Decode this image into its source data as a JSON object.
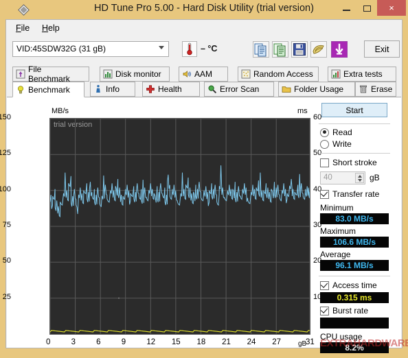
{
  "window": {
    "title": "HD Tune Pro 5.00 - Hard Disk Utility (trial version)",
    "logo_icon": "diamond-logo-icon",
    "minimize_label": "minimize",
    "maximize_label": "maximize",
    "close_label": "×",
    "titlebar_color": "#e8c77e",
    "close_color": "#c75b57"
  },
  "menu": {
    "items": [
      {
        "accel": "F",
        "rest": "ile"
      },
      {
        "accel": "H",
        "rest": "elp"
      }
    ]
  },
  "toolbar": {
    "drive": "VID:45SDW32G (31 gB)",
    "drive_caret_icon": "chevron-down-icon",
    "temperature_icon": "thermometer-icon",
    "temperature": "– °C",
    "buttons": [
      {
        "name": "copy-to-clipboard-icon"
      },
      {
        "name": "copy-to-excel-icon"
      },
      {
        "name": "save-icon"
      },
      {
        "name": "screenshot-icon"
      },
      {
        "name": "download-icon"
      }
    ],
    "exit_label": "Exit"
  },
  "tabs": {
    "row1": [
      {
        "label": "File Benchmark",
        "icon": "file-benchmark-icon",
        "active": false
      },
      {
        "label": "Disk monitor",
        "icon": "disk-monitor-icon",
        "active": false
      },
      {
        "label": "AAM",
        "icon": "aam-speaker-icon",
        "active": false
      },
      {
        "label": "Random Access",
        "icon": "random-access-icon",
        "active": false
      },
      {
        "label": "Extra tests",
        "icon": "extra-tests-icon",
        "active": false
      }
    ],
    "row2": [
      {
        "label": "Benchmark",
        "icon": "benchmark-bulb-icon",
        "active": true
      },
      {
        "label": "Info",
        "icon": "info-icon",
        "active": false
      },
      {
        "label": "Health",
        "icon": "health-cross-icon",
        "active": false
      },
      {
        "label": "Error Scan",
        "icon": "error-scan-magnifier-icon",
        "active": false
      },
      {
        "label": "Folder Usage",
        "icon": "folder-usage-icon",
        "active": false
      },
      {
        "label": "Erase",
        "icon": "erase-trash-icon",
        "active": false
      }
    ]
  },
  "panel": {
    "start_label": "Start",
    "mode": {
      "read_label": "Read",
      "write_label": "Write",
      "selected": "Read"
    },
    "short_stroke": {
      "label": "Short stroke",
      "checked": false,
      "value": "40",
      "unit": "gB"
    },
    "transfer_rate": {
      "label": "Transfer rate",
      "checked": true
    },
    "minimum": {
      "label": "Minimum",
      "value": "83.0 MB/s"
    },
    "maximum": {
      "label": "Maximum",
      "value": "106.6 MB/s"
    },
    "average": {
      "label": "Average",
      "value": "96.1 MB/s"
    },
    "access_time": {
      "label": "Access time",
      "checked": true,
      "value": "0.315 ms"
    },
    "burst_rate": {
      "label": "Burst rate",
      "checked": true,
      "value": ""
    },
    "cpu_usage": {
      "label": "CPU usage",
      "value": "8.2%"
    }
  },
  "watermark": "EXTRAHARDWARE",
  "chart_data": {
    "type": "line",
    "title": "",
    "trial_note": "trial version",
    "xlabel": "gB",
    "ylabel": "MB/s",
    "y2label": "ms",
    "xlim": [
      0,
      31
    ],
    "ylim": [
      0,
      150
    ],
    "y2lim": [
      0,
      60
    ],
    "grid": true,
    "legend": "none",
    "xticks": [
      0,
      3,
      6,
      9,
      12,
      15,
      18,
      21,
      24,
      27,
      31
    ],
    "xticklabels": [
      "0",
      "3",
      "6",
      "9",
      "12",
      "15",
      "18",
      "21",
      "24",
      "27",
      "31"
    ],
    "yticks": [
      0,
      25,
      50,
      75,
      100,
      125,
      150
    ],
    "y2ticks": [
      0,
      10,
      20,
      30,
      40,
      50,
      60
    ],
    "series": [
      {
        "name": "Transfer rate",
        "color": "#7ec8ec",
        "axis": "left",
        "unit": "MB/s",
        "x": [
          0.0,
          0.3,
          0.6,
          0.9,
          1.2,
          1.6,
          1.9,
          2.2,
          2.5,
          2.8,
          3.1,
          3.4,
          3.7,
          4.0,
          4.4,
          4.7,
          5.0,
          5.3,
          5.6,
          5.9,
          6.2,
          6.5,
          6.8,
          7.2,
          7.5,
          7.8,
          8.1,
          8.4,
          8.7,
          9.0,
          9.3,
          9.6,
          10.0,
          10.3,
          10.6,
          10.9,
          11.2,
          11.5,
          11.8,
          12.1,
          12.4,
          12.8,
          13.1,
          13.4,
          13.7,
          14.0,
          14.3,
          14.6,
          14.9,
          15.2,
          15.6,
          15.9,
          16.2,
          16.5,
          16.8,
          17.1,
          17.4,
          17.7,
          18.0,
          18.4,
          18.7,
          19.0,
          19.3,
          19.6,
          19.9,
          20.2,
          20.5,
          20.8,
          21.2,
          21.5,
          21.8,
          22.1,
          22.4,
          22.7,
          23.0,
          23.3,
          23.6,
          24.0,
          24.3,
          24.6,
          24.9,
          25.2,
          25.5,
          25.8,
          26.1,
          26.4,
          26.8,
          27.1,
          27.4,
          27.7,
          28.0,
          28.3,
          28.6,
          28.9,
          29.2,
          29.6,
          29.9,
          30.2,
          30.5,
          30.8,
          31.0
        ],
        "y": [
          92,
          96,
          88,
          84,
          92,
          98,
          95,
          105,
          91,
          96,
          90,
          97,
          93,
          100,
          94,
          101,
          96,
          92,
          97,
          91,
          96,
          99,
          94,
          100,
          95,
          103,
          97,
          92,
          96,
          99,
          95,
          98,
          94,
          100,
          96,
          93,
          97,
          95,
          100,
          96,
          98,
          94,
          100,
          97,
          92,
          106,
          96,
          99,
          95,
          92,
          98,
          96,
          104,
          97,
          93,
          99,
          96,
          101,
          95,
          98,
          94,
          100,
          96,
          99,
          92,
          103,
          97,
          95,
          99,
          96,
          101,
          94,
          98,
          96,
          100,
          97,
          93,
          99,
          96,
          102,
          98,
          95,
          100,
          97,
          94,
          101,
          97,
          99,
          95,
          100,
          96,
          98,
          103,
          96,
          99,
          97,
          100,
          96,
          98,
          97,
          99
        ]
      },
      {
        "name": "Access time",
        "color": "#e8e82a",
        "axis": "right",
        "unit": "ms",
        "approx_value": 0.315,
        "note": "flat near 0 ms along full span"
      }
    ]
  }
}
